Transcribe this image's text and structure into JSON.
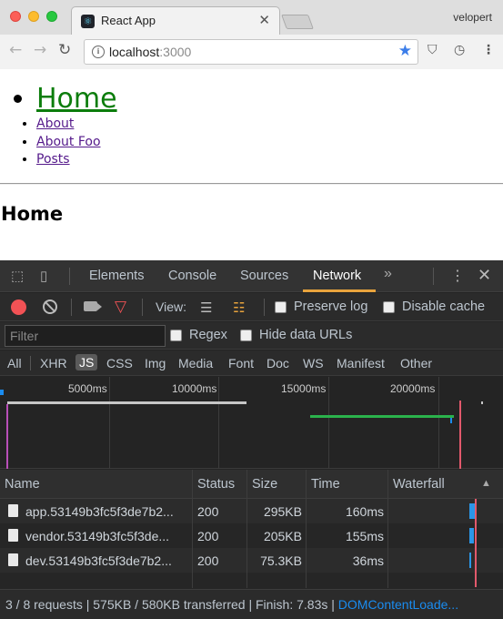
{
  "browser": {
    "tab_title": "React App",
    "profile_name": "velopert",
    "url_host": "localhost",
    "url_port": ":3000"
  },
  "page": {
    "nav": [
      {
        "label": "Home",
        "active": true
      },
      {
        "label": "About"
      },
      {
        "label": "About Foo"
      },
      {
        "label": "Posts"
      }
    ],
    "heading": "Home"
  },
  "devtools": {
    "tabs": [
      "Elements",
      "Console",
      "Sources",
      "Network"
    ],
    "active_tab": "Network",
    "view_label": "View:",
    "preserve_log": "Preserve log",
    "disable_cache": "Disable cache",
    "filter_placeholder": "Filter",
    "regex_label": "Regex",
    "hide_data_urls_label": "Hide data URLs",
    "type_filters": [
      "All",
      "XHR",
      "JS",
      "CSS",
      "Img",
      "Media",
      "Font",
      "Doc",
      "WS",
      "Manifest",
      "Other"
    ],
    "selected_type": "JS",
    "overview_ticks": [
      "5000ms",
      "10000ms",
      "15000ms",
      "20000ms"
    ],
    "columns": {
      "name": "Name",
      "status": "Status",
      "size": "Size",
      "time": "Time",
      "waterfall": "Waterfall"
    },
    "requests": [
      {
        "name": "app.53149b3fc5f3de7b2...",
        "status": "200",
        "size": "295KB",
        "time": "160ms",
        "waterfall_share": 0.55
      },
      {
        "name": "vendor.53149b3fc5f3de...",
        "status": "200",
        "size": "205KB",
        "time": "155ms",
        "waterfall_share": 0.5
      },
      {
        "name": "dev.53149b3fc5f3de7b2...",
        "status": "200",
        "size": "75.3KB",
        "time": "36ms",
        "waterfall_share": 0.2
      }
    ],
    "status_bar": {
      "summary": "3 / 8 requests | 575KB / 580KB transferred | Finish: 7.83s | ",
      "dcl": "DOMContentLoade..."
    }
  },
  "colors": {
    "accent_tab": "#e8a33d",
    "record": "#f25255",
    "link_active": "#0c7d0c",
    "link": "#551a8b",
    "waterfall_bar": "#2b96e8",
    "dcl_line": "#e2596c"
  },
  "icons": [
    "close-icon",
    "back-icon",
    "forward-icon",
    "reload-icon",
    "info-icon",
    "star-icon",
    "inspect-icon",
    "device-icon",
    "more-icon",
    "kebab-icon",
    "record-icon",
    "clear-icon",
    "camera-icon",
    "filter-icon",
    "list-view-icon",
    "waterfall-view-icon",
    "file-icon"
  ]
}
